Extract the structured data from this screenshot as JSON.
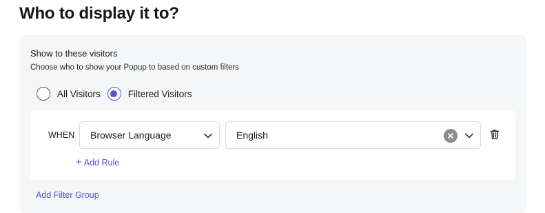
{
  "title": "Who to display it to?",
  "section": {
    "title": "Show to these visitors",
    "description": "Choose who to show your Popup to based on custom filters"
  },
  "visitor_options": [
    {
      "label": "All Visitors",
      "selected": false
    },
    {
      "label": "Filtered Visitors",
      "selected": true
    }
  ],
  "rule": {
    "when_label": "WHEN",
    "field": {
      "value": "Browser Language",
      "icon": "chevron-down-icon"
    },
    "value": {
      "value": "English",
      "clear_icon": "close-icon",
      "icon": "chevron-down-icon"
    },
    "delete_icon": "trash-icon",
    "add_rule_label": "Add Rule",
    "add_rule_icon": "plus-icon"
  },
  "add_filter_group_label": "Add Filter Group",
  "colors": {
    "accent": "#5b4fd6",
    "panel_bg": "#f5f6f7",
    "card_bg": "#ffffff"
  }
}
